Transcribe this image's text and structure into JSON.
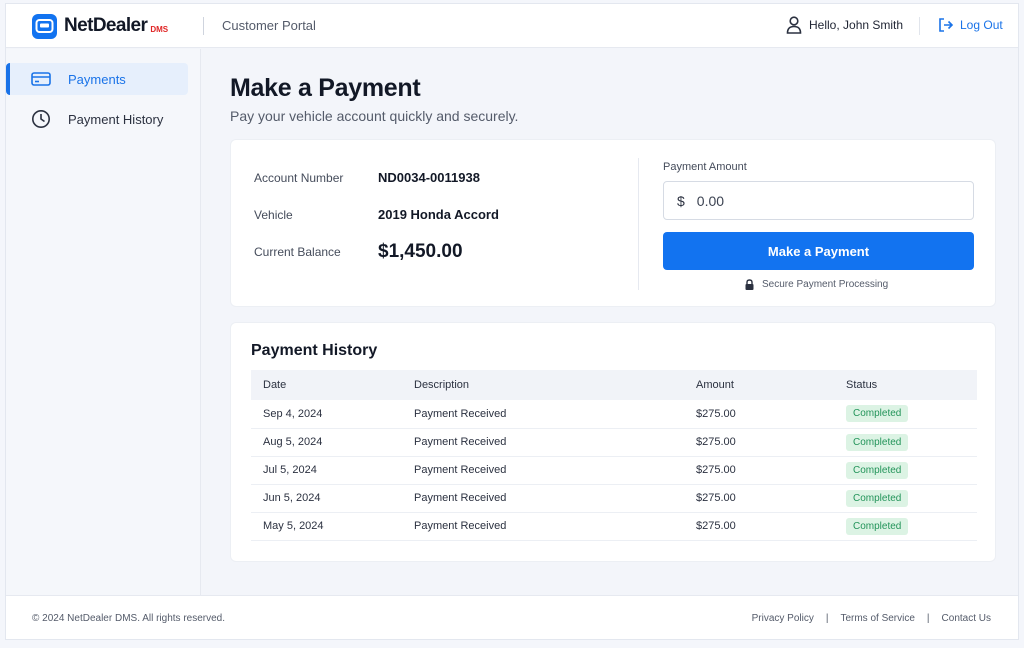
{
  "header": {
    "brand_name": "NetDealer",
    "brand_suffix": "DMS",
    "portal_title": "Customer Portal",
    "greeting": "Hello, John Smith",
    "logout_label": "Log Out"
  },
  "sidebar": {
    "items": [
      {
        "label": "Payments",
        "icon": "credit-card-icon",
        "active": true
      },
      {
        "label": "Payment History",
        "icon": "clock-icon",
        "active": false
      }
    ]
  },
  "main": {
    "title": "Make a Payment",
    "subtitle": "Pay your vehicle account quickly and securely."
  },
  "account": {
    "account_number_label": "Account Number",
    "account_number": "ND0034-0011938",
    "vehicle_label": "Vehicle",
    "vehicle": "2019 Honda Accord",
    "balance_label": "Current Balance",
    "balance": "$1,450.00"
  },
  "payment_form": {
    "amount_label": "Payment Amount",
    "currency_symbol": "$",
    "amount_placeholder": "0.00",
    "submit_label": "Make a Payment",
    "secure_note": "Secure Payment Processing"
  },
  "history": {
    "title": "Payment History",
    "columns": [
      "Date",
      "Description",
      "Amount",
      "Status"
    ],
    "rows": [
      {
        "date": "Sep 4, 2024",
        "description": "Payment Received",
        "amount": "$275.00",
        "status": "Completed"
      },
      {
        "date": "Aug 5, 2024",
        "description": "Payment Received",
        "amount": "$275.00",
        "status": "Completed"
      },
      {
        "date": "Jul 5, 2024",
        "description": "Payment Received",
        "amount": "$275.00",
        "status": "Completed"
      },
      {
        "date": "Jun 5, 2024",
        "description": "Payment Received",
        "amount": "$275.00",
        "status": "Completed"
      },
      {
        "date": "May 5, 2024",
        "description": "Payment Received",
        "amount": "$275.00",
        "status": "Completed"
      }
    ]
  },
  "footer": {
    "copyright": "© 2024 NetDealer DMS. All rights reserved.",
    "links": [
      "Privacy Policy",
      "Terms of Service",
      "Contact Us"
    ],
    "separator": "|"
  },
  "colors": {
    "accent": "#1273f0",
    "status_success_bg": "#dcf3e4",
    "status_success_text": "#23945a",
    "brand_suffix": "#e02424"
  }
}
